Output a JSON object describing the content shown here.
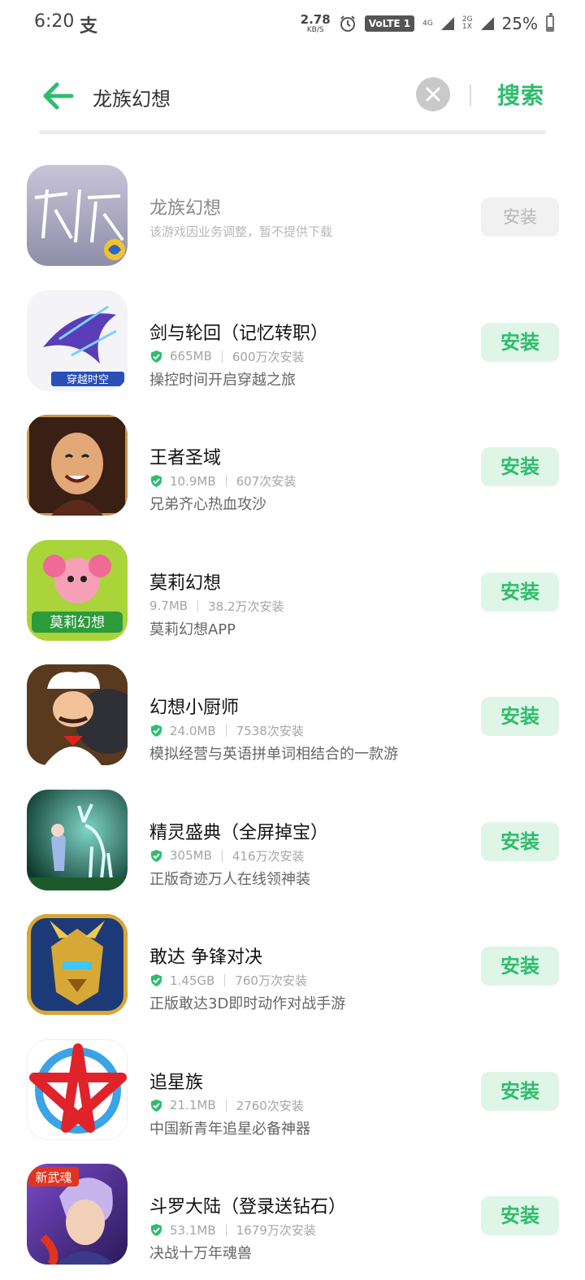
{
  "status_bar": {
    "time": "6:20",
    "pay_glyph": "支",
    "net_speed_value": "2.78",
    "net_speed_unit": "KB/S",
    "volte": "VoLTE 1",
    "net_4g": "4G",
    "net_2g": "2G",
    "net_1x": "1X",
    "battery_text": "25%"
  },
  "search": {
    "query": "龙族幻想",
    "search_button_label": "搜索"
  },
  "apps": [
    {
      "name": "龙族幻想",
      "notice": "该游戏因业务调整，暂不提供下载",
      "button": "安装",
      "disabled": true,
      "icon": "dragon-raja-icon"
    },
    {
      "name": "剑与轮回（记忆转职）",
      "size": "665MB",
      "installs": "600万次安装",
      "desc": "操控时间开启穿越之旅",
      "button": "安装",
      "verified": true,
      "icon": "sword-reincarnation-icon"
    },
    {
      "name": "王者圣域",
      "size": "10.9MB",
      "installs": "607次安装",
      "desc": "兄弟齐心热血攻沙",
      "button": "安装",
      "verified": true,
      "icon": "king-holy-domain-icon"
    },
    {
      "name": "莫莉幻想",
      "size": "9.7MB",
      "installs": "38.2万次安装",
      "desc": "莫莉幻想APP",
      "button": "安装",
      "verified": false,
      "icon": "molly-fantasy-icon",
      "icon_text": "莫莉幻想"
    },
    {
      "name": "幻想小厨师",
      "size": "24.0MB",
      "installs": "7538次安装",
      "desc": "模拟经营与英语拼单词相结合的一款游",
      "button": "安装",
      "verified": true,
      "icon": "fantasy-chef-icon"
    },
    {
      "name": "精灵盛典（全屏掉宝）",
      "size": "305MB",
      "installs": "416万次安装",
      "desc": "正版奇迹万人在线领神装",
      "button": "安装",
      "verified": true,
      "icon": "elf-ceremony-icon"
    },
    {
      "name": "敢达 争锋对决",
      "size": "1.45GB",
      "installs": "760万次安装",
      "desc": "正版敢达3D即时动作对战手游",
      "button": "安装",
      "verified": true,
      "icon": "gundam-icon"
    },
    {
      "name": "追星族",
      "size": "21.1MB",
      "installs": "2760次安装",
      "desc": "中国新青年追星必备神器",
      "button": "安装",
      "verified": true,
      "icon": "star-chaser-icon"
    },
    {
      "name": "斗罗大陆（登录送钻石）",
      "size": "53.1MB",
      "installs": "1679万次安装",
      "desc": "决战十万年魂兽",
      "button": "安装",
      "verified": true,
      "icon": "douluo-icon",
      "icon_text": "新武魂"
    }
  ],
  "colors": {
    "accent": "#2dbd6c",
    "button_bg": "#dff5e7",
    "disabled_button_bg": "#f1f1f1"
  }
}
